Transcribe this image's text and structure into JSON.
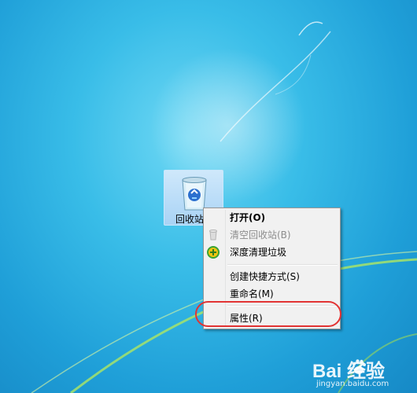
{
  "desktop": {
    "icon_label": "回收站",
    "icon_name": "recycle-bin-icon"
  },
  "context_menu": {
    "items": [
      {
        "label": "打开(O)",
        "bold": true,
        "disabled": false,
        "icon": null
      },
      {
        "label": "清空回收站(B)",
        "bold": false,
        "disabled": true,
        "icon": "empty-bin-icon"
      },
      {
        "label": "深度清理垃圾",
        "bold": false,
        "disabled": false,
        "icon": "deep-clean-icon"
      },
      {
        "label": "创建快捷方式(S)",
        "bold": false,
        "disabled": false,
        "icon": null
      },
      {
        "label": "重命名(M)",
        "bold": false,
        "disabled": false,
        "icon": null
      },
      {
        "label": "属性(R)",
        "bold": false,
        "disabled": false,
        "icon": null
      }
    ]
  },
  "annotation": {
    "color": "#e23333"
  },
  "watermark": {
    "logo": "Bai 经验",
    "url": "jingyan.baidu.com"
  }
}
